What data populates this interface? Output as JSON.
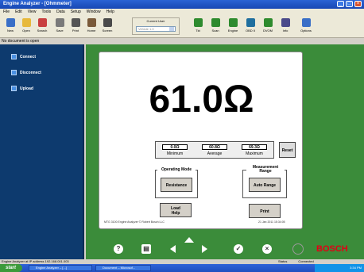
{
  "window": {
    "title": "Engine Analyzer - [Ohmmeter]",
    "minimize": "_",
    "maximize": "□",
    "close": "×"
  },
  "menu": [
    "File",
    "Edit",
    "View",
    "Tools",
    "Data",
    "Setup",
    "Window",
    "Help"
  ],
  "toolbar": {
    "buttons": [
      {
        "label": "New",
        "icon": "new-file-icon",
        "color": "#3a6fc7"
      },
      {
        "label": "Open",
        "icon": "open-folder-icon",
        "color": "#e7b93b"
      },
      {
        "label": "Search",
        "icon": "search-icon",
        "color": "#c94040"
      },
      {
        "label": "Save",
        "icon": "save-icon",
        "color": "#7a7a7a"
      },
      {
        "label": "Print",
        "icon": "print-icon",
        "color": "#555555"
      },
      {
        "label": "Home",
        "icon": "home-icon",
        "color": "#7a5a3a"
      },
      {
        "label": "Screen",
        "icon": "screen-icon",
        "color": "#4a4a4a"
      }
    ],
    "connect_label": "Current User",
    "connect_value": "Vehicle 1.0",
    "right_buttons": [
      {
        "label": "Tkt",
        "icon": "ticket-icon",
        "color": "#2e8b2e"
      },
      {
        "label": "Scan",
        "icon": "scan-icon",
        "color": "#2e8b2e"
      },
      {
        "label": "Engine",
        "icon": "engine-icon",
        "color": "#2e8b2e"
      },
      {
        "label": "OBD II",
        "icon": "obd-icon",
        "color": "#1f6f9f"
      },
      {
        "label": "DVOM",
        "icon": "meter-icon",
        "color": "#2e8b2e"
      },
      {
        "label": "Info",
        "icon": "info-icon",
        "color": "#4a4a8a"
      },
      {
        "label": "Options",
        "icon": "options-icon",
        "color": "#3a6fc7"
      }
    ]
  },
  "no_document": "No document is open",
  "sidebar": {
    "items": [
      {
        "label": "Connect",
        "icon": "connect-icon"
      },
      {
        "label": "Disconnect",
        "icon": "disconnect-icon"
      },
      {
        "label": "Upload",
        "icon": "upload-icon"
      }
    ]
  },
  "meter": {
    "reading": "61.0Ω",
    "minimum_value": "0.0Ω",
    "minimum_label": "Minimum",
    "average_value": "60.8Ω",
    "average_label": "Average",
    "maximum_value": "69.3Ω",
    "maximum_label": "Maximum",
    "reset_label": "Reset",
    "operating_mode_label": "Operating Mode",
    "resistance_button": "Resistance",
    "measurement_range_label": "Measurement Range",
    "auto_range_button": "Auto Range",
    "load_help_line1": "Load",
    "load_help_line2": "Help",
    "print_button": "Print",
    "footer_left": "MTG 3100 Engine Analyzer   © Robert Bosch LLC",
    "footer_right": "21 Jan 2011  15:34:05"
  },
  "brand": "BOSCH",
  "status": {
    "left": "Engine Analyzer at IP address 192.168.001.003",
    "mid1": "Status",
    "mid2": "Connected"
  },
  "taskbar": {
    "start": "start",
    "tasks": [
      "Engine Analyzer – [...]",
      "Document – Microsof..."
    ],
    "clock": "3:34 PM"
  },
  "colors": {
    "accent_green": "#3b8c3a",
    "sidebar_blue": "#0d3a6e",
    "brand_red": "#e20015"
  }
}
